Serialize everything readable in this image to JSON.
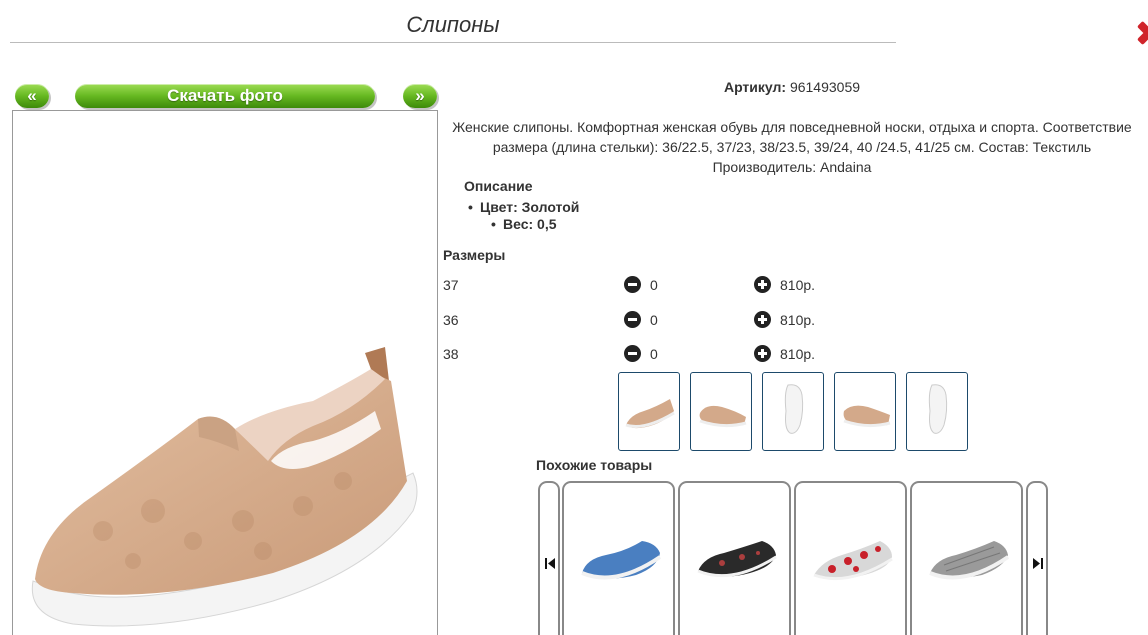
{
  "header": {
    "title": "Слипоны"
  },
  "photo_controls": {
    "prev_label": "«",
    "download_label": "Скачать фото",
    "next_label": "»"
  },
  "product": {
    "article_label": "Артикул:",
    "article_value": "961493059",
    "description_line1": "Женские слипоны. Комфортная женская обувь для повседневной носки, отдыха и спорта. Соответствие",
    "description_line2": "размера (длина стельки): 36/22.5, 37/23, 38/23.5, 39/24, 40 /24.5, 41/25 см. Состав: Текстиль",
    "description_line3": "Производитель: Andaina",
    "opisanie_title": "Описание",
    "color_item": "Цвет: Золотой",
    "weight_item": "Вес: 0,5"
  },
  "sizes": {
    "title": "Размеры",
    "rows": [
      {
        "size": "37",
        "qty": "0",
        "price": "810р."
      },
      {
        "size": "36",
        "qty": "0",
        "price": "810р."
      },
      {
        "size": "38",
        "qty": "0",
        "price": "810р."
      }
    ]
  },
  "similar": {
    "title": "Похожие товары"
  },
  "colors": {
    "green_button": "#66b821",
    "close_red": "#d0242b",
    "thumb_border": "#1d4a6b",
    "shoe_beige": "#d3a98a"
  }
}
